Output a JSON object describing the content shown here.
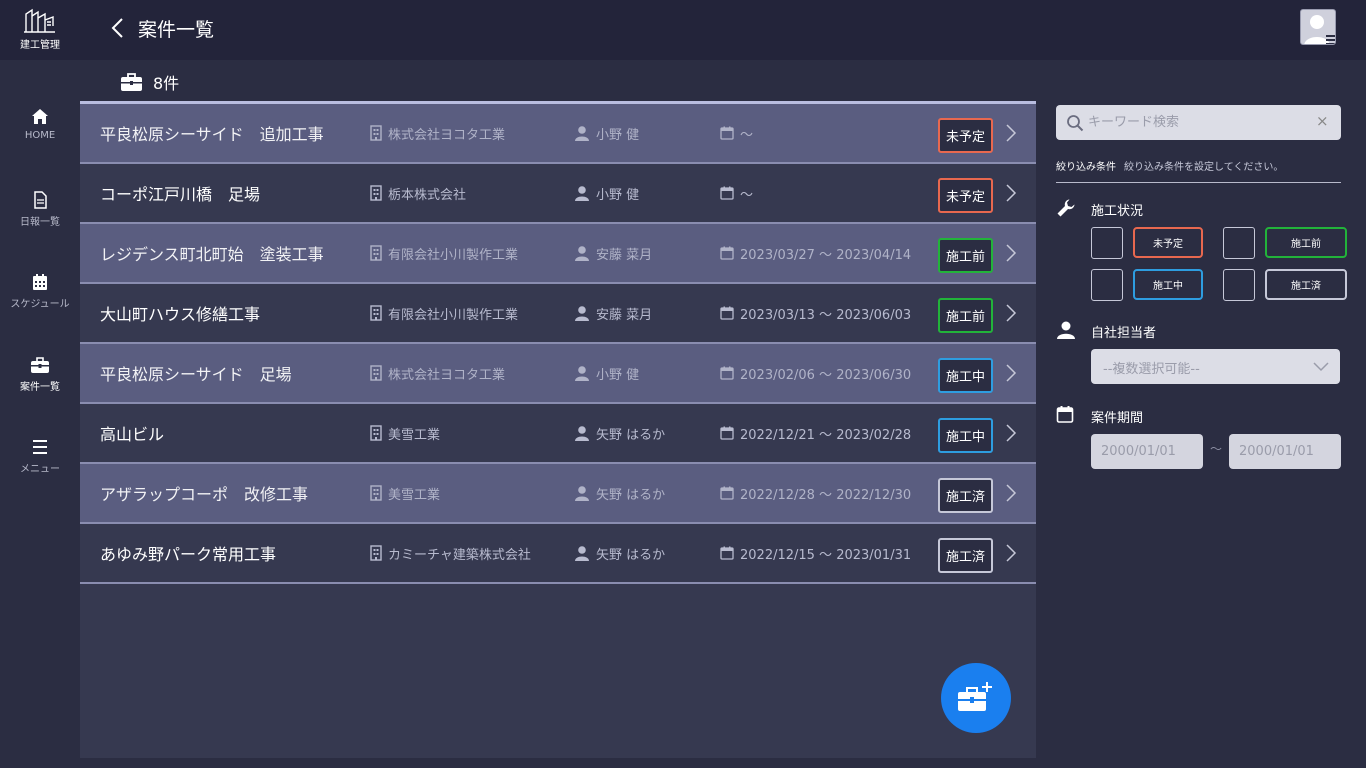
{
  "app": {
    "logo_text": "建工管理",
    "page_title": "案件一覧"
  },
  "sidebar": {
    "items": [
      {
        "label": "HOME",
        "icon": "home-icon"
      },
      {
        "label": "日報一覧",
        "icon": "document-icon"
      },
      {
        "label": "スケジュール",
        "icon": "calendar-icon"
      },
      {
        "label": "案件一覧",
        "icon": "briefcase-icon",
        "active": true
      },
      {
        "label": "メニュー",
        "icon": "menu-icon"
      }
    ]
  },
  "list": {
    "count": "8件",
    "rows": [
      {
        "name": "平良松原シーサイド　追加工事",
        "company": "株式会社ヨコタ工業",
        "person": "小野 健",
        "period": "～",
        "status": "未予定"
      },
      {
        "name": "コーポ江戸川橋　足場",
        "company": "栃本株式会社",
        "person": "小野 健",
        "period": "～",
        "status": "未予定"
      },
      {
        "name": "レジデンス町北町始　塗装工事",
        "company": "有限会社小川製作工業",
        "person": "安藤 菜月",
        "period": "2023/03/27 ～ 2023/04/14",
        "status": "施工前"
      },
      {
        "name": "大山町ハウス修繕工事",
        "company": "有限会社小川製作工業",
        "person": "安藤 菜月",
        "period": "2023/03/13 ～ 2023/06/03",
        "status": "施工前"
      },
      {
        "name": "平良松原シーサイド　足場",
        "company": "株式会社ヨコタ工業",
        "person": "小野 健",
        "period": "2023/02/06 ～ 2023/06/30",
        "status": "施工中"
      },
      {
        "name": "高山ビル",
        "company": "美雪工業",
        "person": "矢野 はるか",
        "period": "2022/12/21 ～ 2023/02/28",
        "status": "施工中"
      },
      {
        "name": "アザラップコーポ　改修工事",
        "company": "美雪工業",
        "person": "矢野 はるか",
        "period": "2022/12/28 ～ 2022/12/30",
        "status": "施工済"
      },
      {
        "name": "あゆみ野パーク常用工事",
        "company": "カミーチャ建築株式会社",
        "person": "矢野 はるか",
        "period": "2022/12/15 ～ 2023/01/31",
        "status": "施工済"
      }
    ]
  },
  "status_colors": {
    "未予定": "#e8684f",
    "施工前": "#22b33a",
    "施工中": "#2e9de0",
    "施工済": "#c6c8d8"
  },
  "filter": {
    "search_placeholder": "キーワード検索",
    "clear_symbol": "×",
    "condition_label": "絞り込み条件",
    "condition_hint": "絞り込み条件を設定してください。",
    "status_section": "施工状況",
    "status_options": [
      "未予定",
      "施工前",
      "施工中",
      "施工済"
    ],
    "staff_section": "自社担当者",
    "staff_placeholder": "--複数選択可能--",
    "period_section": "案件期間",
    "date_from_placeholder": "2000/01/01",
    "date_separator": "～",
    "date_to_placeholder": "2000/01/01"
  },
  "colors": {
    "accent": "#1a7fef",
    "background": "#2b2d42"
  }
}
